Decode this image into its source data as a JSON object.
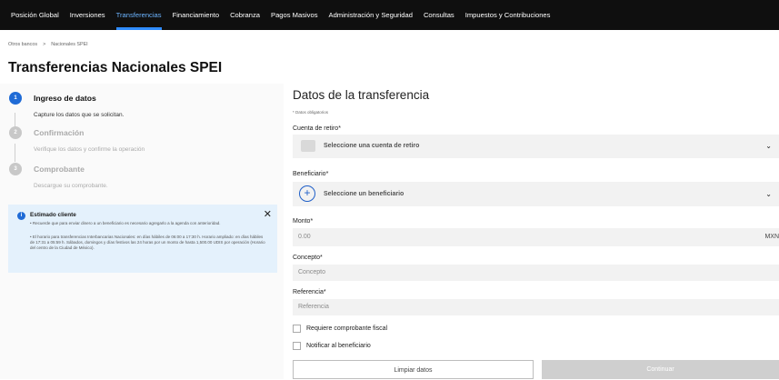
{
  "nav": {
    "items": [
      {
        "label": "Posición Global"
      },
      {
        "label": "Inversiones"
      },
      {
        "label": "Transferencias"
      },
      {
        "label": "Financiamiento"
      },
      {
        "label": "Cobranza"
      },
      {
        "label": "Pagos Masivos"
      },
      {
        "label": "Administración y Seguridad"
      },
      {
        "label": "Consultas"
      },
      {
        "label": "Impuestos y Contribuciones"
      }
    ],
    "active_color": "#2f8cff"
  },
  "breadcrumb": {
    "item1": "Otros bancos",
    "sep": ">",
    "item2": "Nacionales SPEI"
  },
  "page_title": "Transferencias Nacionales SPEI",
  "steps": [
    {
      "num": "1",
      "title": "Ingreso de datos",
      "desc": "Capture los datos que se solicitan.",
      "color": "#1f6bd6"
    },
    {
      "num": "2",
      "title": "Confirmación",
      "desc": "Verifique los datos y confirme la operación",
      "color": "#c8c8c8"
    },
    {
      "num": "3",
      "title": "Comprobante",
      "desc": "Descargue su comprobante.",
      "color": "#c8c8c8"
    }
  ],
  "alert": {
    "icon": "info-icon",
    "title": "Estimado cliente",
    "close": "✕",
    "line1": "• Recuerde que para enviar dinero a un beneficiario es necesario agregarlo a la agenda con anterioridad.",
    "line2": "• El horario para transferencias Interbancarias Nacionales: en días hábiles de 06:00 a 17:30 h. Horario ampliado: en días hábiles de 17:31 a 05:59 h. Sábados, domingos y días festivos las 24 horas por un monto de hasta 1,500.00 UDIS por operación (Horario del centro de la Ciudad de México)."
  },
  "form": {
    "title": "Datos de la transferencia",
    "required_note": "* Datos obligatorios",
    "cuenta_label": "Cuenta de retiro*",
    "cuenta_placeholder": "Seleccione una cuenta de retiro",
    "beneficiario_label": "Beneficiario*",
    "beneficiario_placeholder": "Seleccione un beneficiario",
    "monto_label": "Monto*",
    "monto_value": "0.00",
    "monto_currency": "MXN",
    "concepto_label": "Concepto*",
    "concepto_placeholder": "Concepto",
    "referencia_label": "Referencia*",
    "referencia_placeholder": "Referencia",
    "check1": "Requiere comprobante fiscal",
    "check2": "Notificar al beneficiario",
    "clear_button": "Limpiar datos",
    "continue_button": "Continuar"
  }
}
